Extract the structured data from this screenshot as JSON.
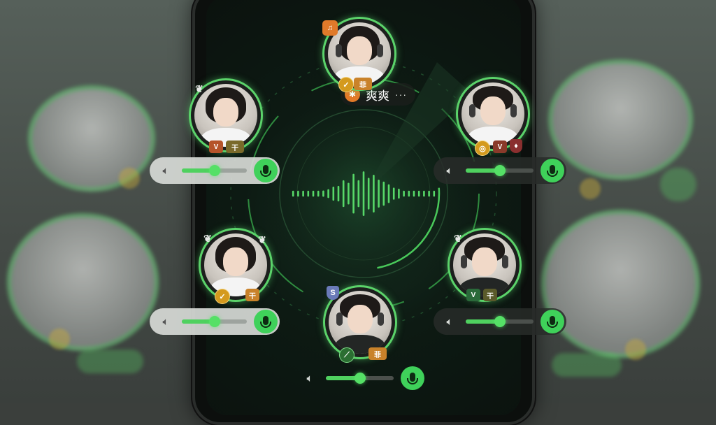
{
  "app": {
    "accent": "#4fd15f"
  },
  "host": {
    "name": "爽爽",
    "menu": "···",
    "icon": "leaf-icon"
  },
  "participants": [
    {
      "id": "top-center",
      "badges": [
        "gold-coin",
        "level-tag"
      ]
    },
    {
      "id": "upper-left",
      "badges": [
        "wing",
        "level-tag",
        "level-tag"
      ]
    },
    {
      "id": "upper-right",
      "badges": [
        "gold-coin",
        "level-tag",
        "shield"
      ]
    },
    {
      "id": "lower-left",
      "badges": [
        "wing",
        "wing",
        "gold-coin",
        "level-tag"
      ]
    },
    {
      "id": "lower-right",
      "badges": [
        "wing",
        "level-tag"
      ]
    },
    {
      "id": "bottom-center",
      "badges": [
        "shield",
        "green-coin",
        "level-tag"
      ]
    }
  ],
  "volume_controls": [
    {
      "id": "left-upper",
      "level": 0.5
    },
    {
      "id": "right-upper",
      "level": 0.5
    },
    {
      "id": "left-lower",
      "level": 0.5
    },
    {
      "id": "right-lower",
      "level": 0.5
    },
    {
      "id": "bottom",
      "level": 0.5
    }
  ],
  "icons": {
    "speaker": "speaker-icon",
    "mic": "microphone-icon"
  }
}
